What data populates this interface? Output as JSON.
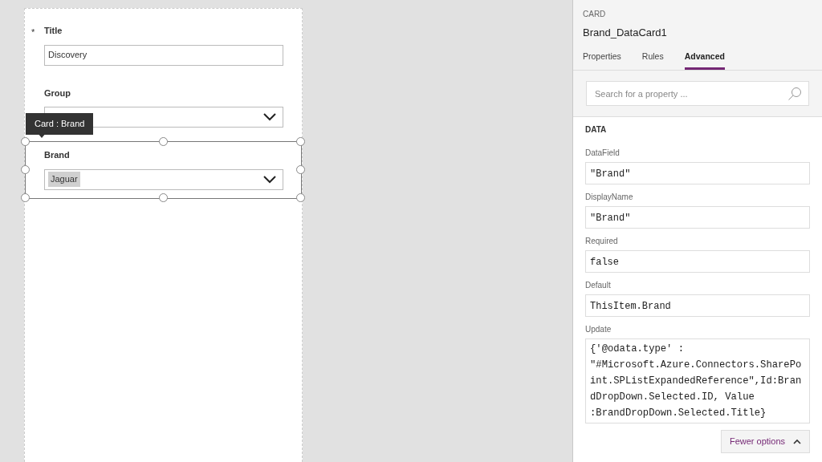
{
  "form": {
    "fields": [
      {
        "label": "Title",
        "required": true,
        "kind": "text",
        "value": "Discovery",
        "selected": false
      },
      {
        "label": "Group",
        "required": false,
        "kind": "dropdown",
        "selected": false
      },
      {
        "label": "Brand",
        "required": false,
        "kind": "dropdown",
        "value": "Jaguar",
        "selected": true
      }
    ],
    "tooltip": "Card : Brand",
    "required_mark": "*"
  },
  "panel": {
    "type_label": "CARD",
    "title": "Brand_DataCard1",
    "tabs": [
      {
        "label": "Properties",
        "selected": false
      },
      {
        "label": "Rules",
        "selected": false
      },
      {
        "label": "Advanced",
        "selected": true
      }
    ],
    "search": {
      "placeholder": "Search for a property ..."
    },
    "section": "DATA",
    "properties": [
      {
        "label": "DataField",
        "value": "\"Brand\""
      },
      {
        "label": "DisplayName",
        "value": "\"Brand\""
      },
      {
        "label": "Required",
        "value": "false"
      },
      {
        "label": "Default",
        "value": "ThisItem.Brand"
      },
      {
        "label": "Update",
        "value": "{'@odata.type' : \"#Microsoft.Azure.Connectors.SharePoint.SPListExpandedReference\",Id:BrandDropDown.Selected.ID, Value :BrandDropDown.Selected.Title}"
      }
    ],
    "fewer_button": "Fewer options"
  }
}
